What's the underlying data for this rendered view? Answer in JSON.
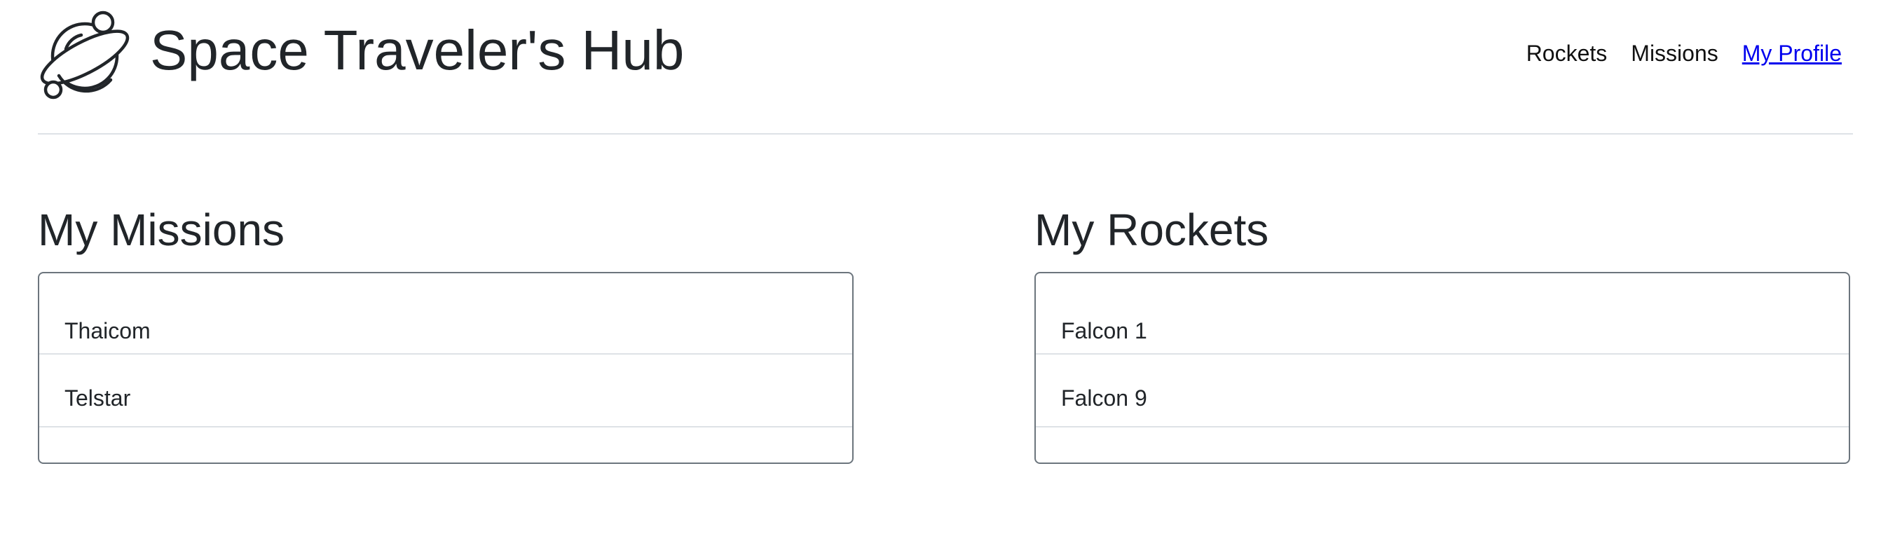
{
  "header": {
    "title": "Space Traveler's Hub",
    "logo_icon": "planet-logo-icon"
  },
  "nav": {
    "items": [
      {
        "label": "Rockets",
        "active": false
      },
      {
        "label": "Missions",
        "active": false
      },
      {
        "label": "My Profile",
        "active": true
      }
    ],
    "active_color": "#0000ee"
  },
  "missions": {
    "title": "My Missions",
    "items": [
      "Thaicom",
      "Telstar"
    ]
  },
  "rockets": {
    "title": "My Rockets",
    "items": [
      "Falcon 1",
      "Falcon 9"
    ]
  }
}
